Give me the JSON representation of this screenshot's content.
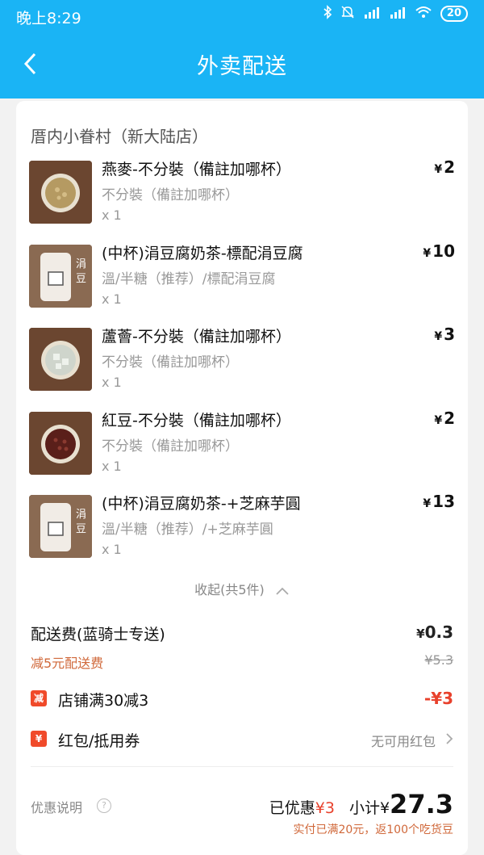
{
  "status_bar": {
    "time": "晚上8:29",
    "icons": [
      "bluetooth-icon",
      "mute-icon",
      "signal-hd-icon",
      "signal-icon",
      "wifi-icon"
    ],
    "battery": "20"
  },
  "header": {
    "title": "外卖配送",
    "background_color": "#1ab4f5"
  },
  "shop": {
    "name": "厝内小眷村（新大陆店）"
  },
  "items": [
    {
      "name": "燕麥-不分裝（備註加哪杯）",
      "spec": "不分裝（備註加哪杯）",
      "qty": "x 1",
      "currency": "¥",
      "price": "2"
    },
    {
      "name": "(中杯)涓豆腐奶茶-標配涓豆腐",
      "spec": "溫/半糖（推荐）/標配涓豆腐",
      "qty": "x 1",
      "currency": "¥",
      "price": "10"
    },
    {
      "name": "蘆薈-不分裝（備註加哪杯）",
      "spec": "不分裝（備註加哪杯）",
      "qty": "x 1",
      "currency": "¥",
      "price": "3"
    },
    {
      "name": "紅豆-不分裝（備註加哪杯）",
      "spec": "不分裝（備註加哪杯）",
      "qty": "x 1",
      "currency": "¥",
      "price": "2"
    },
    {
      "name": "(中杯)涓豆腐奶茶-+芝麻芋圓",
      "spec": "溫/半糖（推荐）/+芝麻芋圓",
      "qty": "x 1",
      "currency": "¥",
      "price": "13"
    }
  ],
  "collapse_label": "收起(共5件)",
  "delivery": {
    "label": "配送费(蓝骑士专送)",
    "currency": "¥",
    "fee": "0.3",
    "discount_label": "减5元配送费",
    "original_fee": "¥5.3"
  },
  "promo": {
    "icon_text": "减",
    "label": "店铺满30减3",
    "amount": "-¥3"
  },
  "coupon": {
    "icon_text": "¥",
    "label": "红包/抵用券",
    "status": "无可用红包"
  },
  "summary": {
    "note": "优惠说明",
    "saved_label": "已优惠",
    "saved_amount": "¥3",
    "subtotal_label": "小计",
    "subtotal_currency": "¥",
    "subtotal_amount": "27.3",
    "reward": "实付已满20元，返100个吃货豆"
  }
}
